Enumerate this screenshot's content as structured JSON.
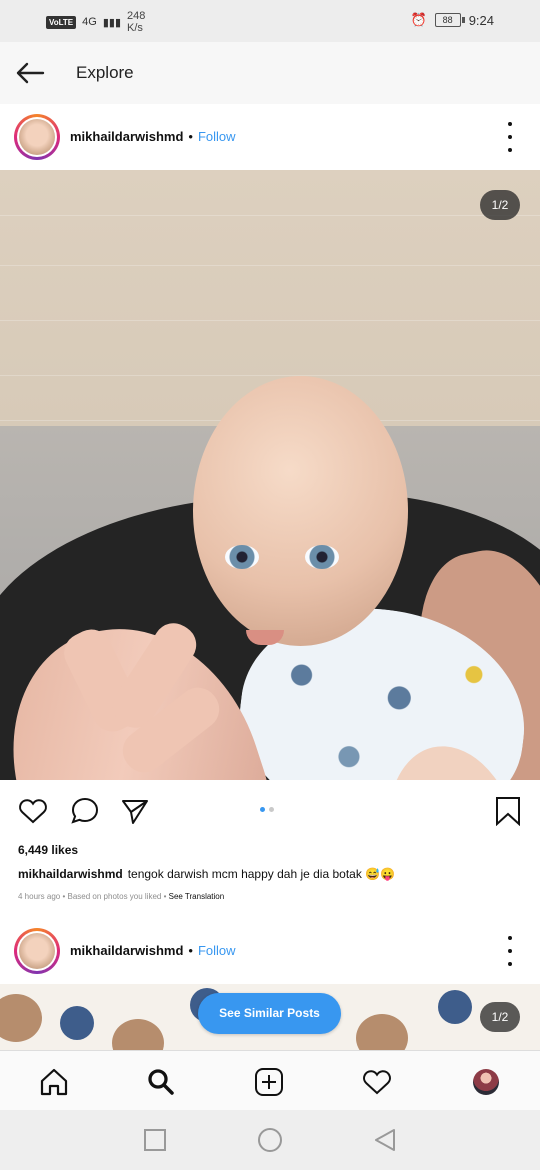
{
  "status_bar": {
    "network": "VoLTE",
    "signal": "4G",
    "net_speed": "248",
    "net_speed_unit": "K/s",
    "battery": "88",
    "time": "9:24"
  },
  "header": {
    "title": "Explore"
  },
  "posts": [
    {
      "username": "mikhaildarwishmd",
      "follow": "Follow",
      "counter": "1/2",
      "likes": "6,449 likes",
      "caption": "tengok darwish mcm happy dah je dia botak 😅😛",
      "time": "4 hours ago",
      "reason": "Based on photos you liked",
      "translation": "See Translation"
    },
    {
      "username": "mikhaildarwishmd",
      "follow": "Follow",
      "counter": "1/2"
    }
  ],
  "buttons": {
    "see_similar": "See Similar Posts"
  },
  "icons": {
    "back": "back-arrow-icon",
    "more": "more-options-icon",
    "like": "heart-icon",
    "comment": "comment-icon",
    "share": "share-icon",
    "save": "bookmark-icon",
    "home": "home-icon",
    "search": "search-icon",
    "add": "add-icon",
    "activity": "heart-icon",
    "profile": "profile-avatar",
    "recent_apps": "square-icon",
    "home_system": "circle-icon",
    "back_system": "triangle-icon"
  },
  "colors": {
    "accent": "#3897f0",
    "text": "#111111",
    "muted": "#8e8e8e"
  }
}
